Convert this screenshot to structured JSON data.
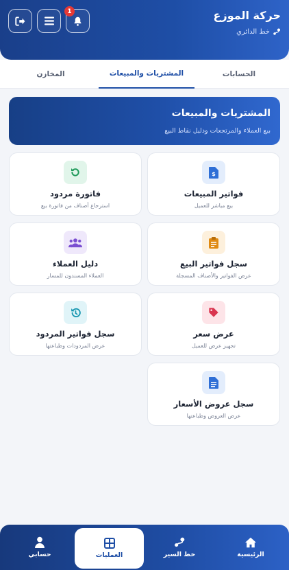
{
  "header": {
    "title": "حركة الموزع",
    "subtitle": "خط الدائري",
    "notification_count": "1"
  },
  "tabs": [
    {
      "label": "الحسابات"
    },
    {
      "label": "المشتريات والمبيعات"
    },
    {
      "label": "المخازن"
    }
  ],
  "banner": {
    "title": "المشتريات والمبيعات",
    "subtitle": "بيع العملاء والمرتجعات ودليل نقاط البيع"
  },
  "cards": [
    {
      "title": "فواتير المبيعات",
      "desc": "بيع مباشر للعميل",
      "icon": "invoice-dollar-icon",
      "color": "#2f6fd6",
      "bg": "#e3edfc"
    },
    {
      "title": "فاتورة مردود",
      "desc": "استرجاع أصناف من فاتورة بيع",
      "icon": "undo-icon",
      "color": "#1f9a5a",
      "bg": "#e1f5ea"
    },
    {
      "title": "سجل فواتير البيع",
      "desc": "عرض الفواتير والأصناف المسجلة",
      "icon": "clipboard-icon",
      "color": "#e08a12",
      "bg": "#fdf0dc"
    },
    {
      "title": "دليل العملاء",
      "desc": "العملاء المسندون للمسار",
      "icon": "users-icon",
      "color": "#7b4fd1",
      "bg": "#efe8fb"
    },
    {
      "title": "عرض سعر",
      "desc": "تجهيز عرض للعميل",
      "icon": "tag-icon",
      "color": "#d9354f",
      "bg": "#fde4e8"
    },
    {
      "title": "سجل فواتير المردود",
      "desc": "عرض المردودات وطباعتها",
      "icon": "history-icon",
      "color": "#1696b0",
      "bg": "#e0f4f8"
    },
    {
      "title": "سجل عروض الأسعار",
      "desc": "عرض العروض وطباعتها",
      "icon": "document-icon",
      "color": "#2f6fd6",
      "bg": "#e3edfc"
    }
  ],
  "bottom_nav": [
    {
      "label": "الرئيسية",
      "icon": "home-icon"
    },
    {
      "label": "خط السير",
      "icon": "route-icon"
    },
    {
      "label": "العمليات",
      "icon": "grid-icon"
    },
    {
      "label": "حسابي",
      "icon": "user-icon"
    }
  ]
}
